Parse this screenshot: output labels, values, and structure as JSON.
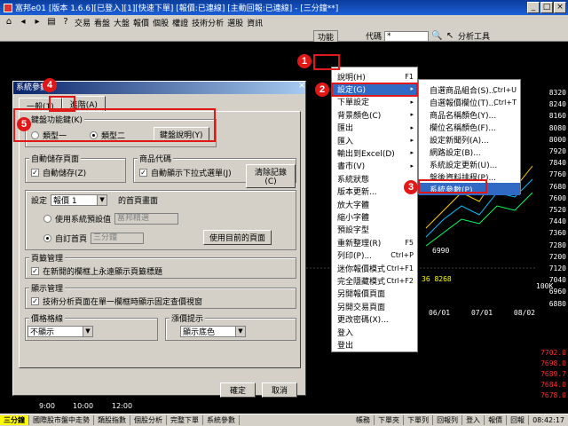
{
  "window": {
    "title": "富邦e01 [版本 1.6.6][已登入][1][快速下單] [報價:已連線] [主動回報:已連線] - [三分鐘**]",
    "buttons": [
      "_",
      "□",
      "×"
    ]
  },
  "toolbar": {
    "row1": [
      "交易",
      "看盤",
      "大盤",
      "報價",
      "個股",
      "權證",
      "技術分析",
      "選股",
      "資訊"
    ],
    "function_label": "功能",
    "code_label": "代碼",
    "code_value": "*",
    "analysis_label": "分析工具"
  },
  "dialog": {
    "title": "系統參數",
    "close": "×",
    "tabs": [
      "一般(1)",
      "進階(A)"
    ],
    "active_tab": 1,
    "keyboard": {
      "label": "鍵盤功能鍵(K)",
      "option1": "類型一",
      "option2": "類型二",
      "explain_btn": "鍵盤說明(Y)"
    },
    "auto_save": {
      "label": "自動儲存頁面",
      "checkbox": "自動儲存(Z)"
    },
    "product_code": {
      "label": "商品代碼",
      "checkbox": "自動顯示下拉式選單(J)",
      "clear_btn": "清除記錄(C)"
    },
    "homepage": {
      "set_label": "設定",
      "select_value": "報價 1",
      "suffix": "的首頁畫面",
      "opt_default": "使用系統預設值",
      "default_value": "富邦精選",
      "opt_custom": "自訂首頁",
      "custom_value": "三分鐘",
      "use_current_btn": "使用目前的頁面"
    },
    "page_manage": {
      "label": "頁籤管理",
      "checkbox": "在新開的欄框上永遠顯示頁籤標題"
    },
    "display_manage": {
      "label": "顯示管理",
      "checkbox": "技術分析頁面在單一欄框時顯示固定查價視窗"
    },
    "price_grid": {
      "label": "價格格線",
      "value": "不顯示"
    },
    "up_down": {
      "label": "漲價提示",
      "value": "顯示底色"
    },
    "ok_btn": "確定",
    "cancel_btn": "取消"
  },
  "menu": {
    "items": [
      {
        "label": "說明(H)",
        "key": "F1",
        "arrow": ""
      },
      {
        "label": "設定(G)",
        "key": "",
        "arrow": "▸",
        "hl": true
      },
      {
        "label": "下單設定",
        "key": "",
        "arrow": "▸"
      },
      {
        "label": "背景顏色(C)",
        "key": "",
        "arrow": "▸"
      },
      {
        "label": "匯出",
        "key": "",
        "arrow": "▸"
      },
      {
        "label": "匯入",
        "key": "",
        "arrow": "▸"
      },
      {
        "label": "輸出到Excel(D)",
        "key": "",
        "arrow": "▸"
      },
      {
        "label": "書市(V)",
        "key": "",
        "arrow": "▸"
      },
      {
        "label": "系統狀態",
        "key": "",
        "arrow": ""
      },
      {
        "label": "版本更新...",
        "key": "",
        "arrow": ""
      },
      {
        "label": "放大字體",
        "key": "",
        "arrow": ""
      },
      {
        "label": "縮小字體",
        "key": "",
        "arrow": ""
      },
      {
        "label": "預設字型",
        "key": "",
        "arrow": ""
      },
      {
        "label": "重新整理(R)",
        "key": "F5",
        "arrow": ""
      },
      {
        "label": "列印(P)...",
        "key": "Ctrl+P",
        "arrow": ""
      },
      {
        "label": "迷你報價模式",
        "key": "Ctrl+F1",
        "arrow": ""
      },
      {
        "label": "完全隱藏模式",
        "key": "Ctrl+F2",
        "arrow": ""
      },
      {
        "label": "另開報價頁面",
        "key": "",
        "arrow": ""
      },
      {
        "label": "另開交易頁面",
        "key": "",
        "arrow": ""
      },
      {
        "label": "更改密碼(X)...",
        "key": "",
        "arrow": ""
      },
      {
        "label": "登入",
        "key": "",
        "arrow": ""
      },
      {
        "label": "登出",
        "key": "",
        "arrow": ""
      }
    ]
  },
  "submenu": {
    "items": [
      {
        "label": "自選商品組合(S)...",
        "key": "Ctrl+U"
      },
      {
        "label": "自選報價欄位(T)...",
        "key": "Ctrl+T"
      },
      {
        "label": "商品名稱顏色(Y)...",
        "key": ""
      },
      {
        "label": "欄位名稱顏色(F)...",
        "key": ""
      },
      {
        "label": "設定新聞列(A)...",
        "key": ""
      },
      {
        "label": "網路設定(B)...",
        "key": ""
      },
      {
        "label": "系統設定更新(U)...",
        "key": ""
      },
      {
        "label": "盤後資料排程(P)...",
        "key": ""
      },
      {
        "label": "系統參數(P)...",
        "key": "",
        "hl": true
      }
    ]
  },
  "markers": [
    "1",
    "2",
    "3",
    "4",
    "5"
  ],
  "axis": {
    "right": [
      "8320",
      "8240",
      "8160",
      "8080",
      "8000",
      "7920",
      "7840",
      "7760",
      "7680",
      "7600",
      "7520",
      "7440",
      "7360",
      "7280",
      "7200",
      "7120",
      "7040",
      "6960",
      "6880"
    ],
    "low_panel": [
      "100K"
    ],
    "dates": [
      "06/01",
      "07/01",
      "08/02"
    ],
    "red": [
      "7702.0",
      "7698.0",
      "7689.7",
      "7684.0",
      "7678.0"
    ],
    "misc": [
      "6990",
      "36 8268"
    ],
    "time": [
      "9:00",
      "10:00",
      "12:00"
    ]
  },
  "statusbar": {
    "tabs": [
      "三分鐘",
      "國際股市盤中走勢",
      "類股指數",
      "個股分析",
      "完整下單",
      "系統參數"
    ],
    "active": 0,
    "right": [
      "帳務",
      "下單夾",
      "下單列",
      "回報列",
      "登入",
      "報價",
      "回報"
    ],
    "time": "08:42:17"
  }
}
